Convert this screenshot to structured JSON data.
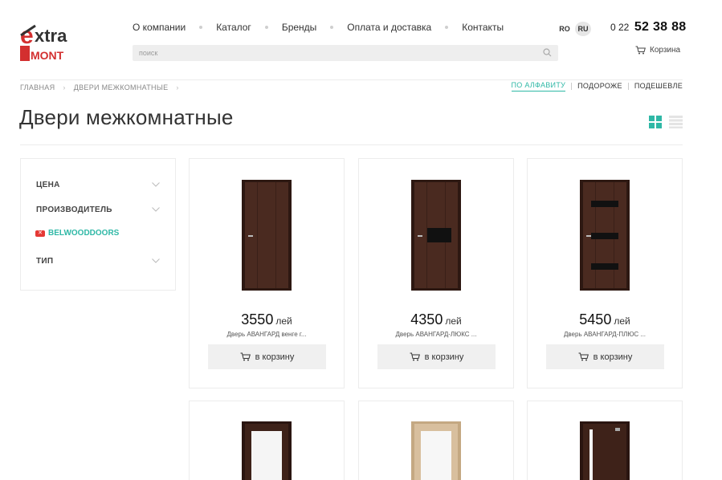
{
  "brand": {
    "logo_top": "xtra",
    "logo_e": "e",
    "logo_bottom": "MONT",
    "logo_red": "#d32f2f",
    "logo_dark": "#333333"
  },
  "nav": [
    "О компании",
    "Каталог",
    "Бренды",
    "Оплата и доставка",
    "Контакты"
  ],
  "search": {
    "placeholder": "поиск",
    "icon": "search-icon"
  },
  "languages": {
    "ro": "RO",
    "ru": "RU"
  },
  "phone": {
    "code": "0 22",
    "number": "52 38 88"
  },
  "cart": {
    "label": "Корзина",
    "icon": "cart-icon"
  },
  "breadcrumb": [
    "ГЛАВНАЯ",
    "ДВЕРИ МЕЖКОМНАТНЫЕ"
  ],
  "sort": {
    "options": [
      "ПО АЛФАВИТУ",
      "ПОДОРОЖЕ",
      "ПОДЕШЕВЛЕ"
    ],
    "active": "ПО АЛФАВИТУ"
  },
  "page_title": "Двери межкомнатные",
  "view_modes": {
    "active": "grid",
    "icons": [
      "grid-view-icon",
      "list-view-icon"
    ]
  },
  "filters": {
    "price": "ЦЕНА",
    "manufacturer": "ПРОИЗВОДИТЕЛЬ",
    "active_brand": "BELWOODDOORS",
    "type": "ТИП"
  },
  "products": [
    {
      "price": "3550",
      "currency": "лей",
      "name": "Дверь АВАНГАРД венге г...",
      "button": "в корзину",
      "door_color": "#4a2a20",
      "insert": "none"
    },
    {
      "price": "4350",
      "currency": "лей",
      "name": "Дверь АВАНГАРД-ЛЮКС ...",
      "button": "в корзину",
      "door_color": "#4a2a20",
      "insert": "black-square"
    },
    {
      "price": "5450",
      "currency": "лей",
      "name": "Дверь АВАНГАРД-ПЛЮС ...",
      "button": "в корзину",
      "door_color": "#4a2a20",
      "insert": "black-stripes"
    },
    {
      "door_color": "#3e2219",
      "insert": "glass"
    },
    {
      "door_color": "#d8bf9e",
      "insert": "glass"
    },
    {
      "door_color": "#3e2219",
      "insert": "glass-side"
    }
  ],
  "colors": {
    "accent": "#2fb8a6",
    "remove": "#e53935"
  }
}
